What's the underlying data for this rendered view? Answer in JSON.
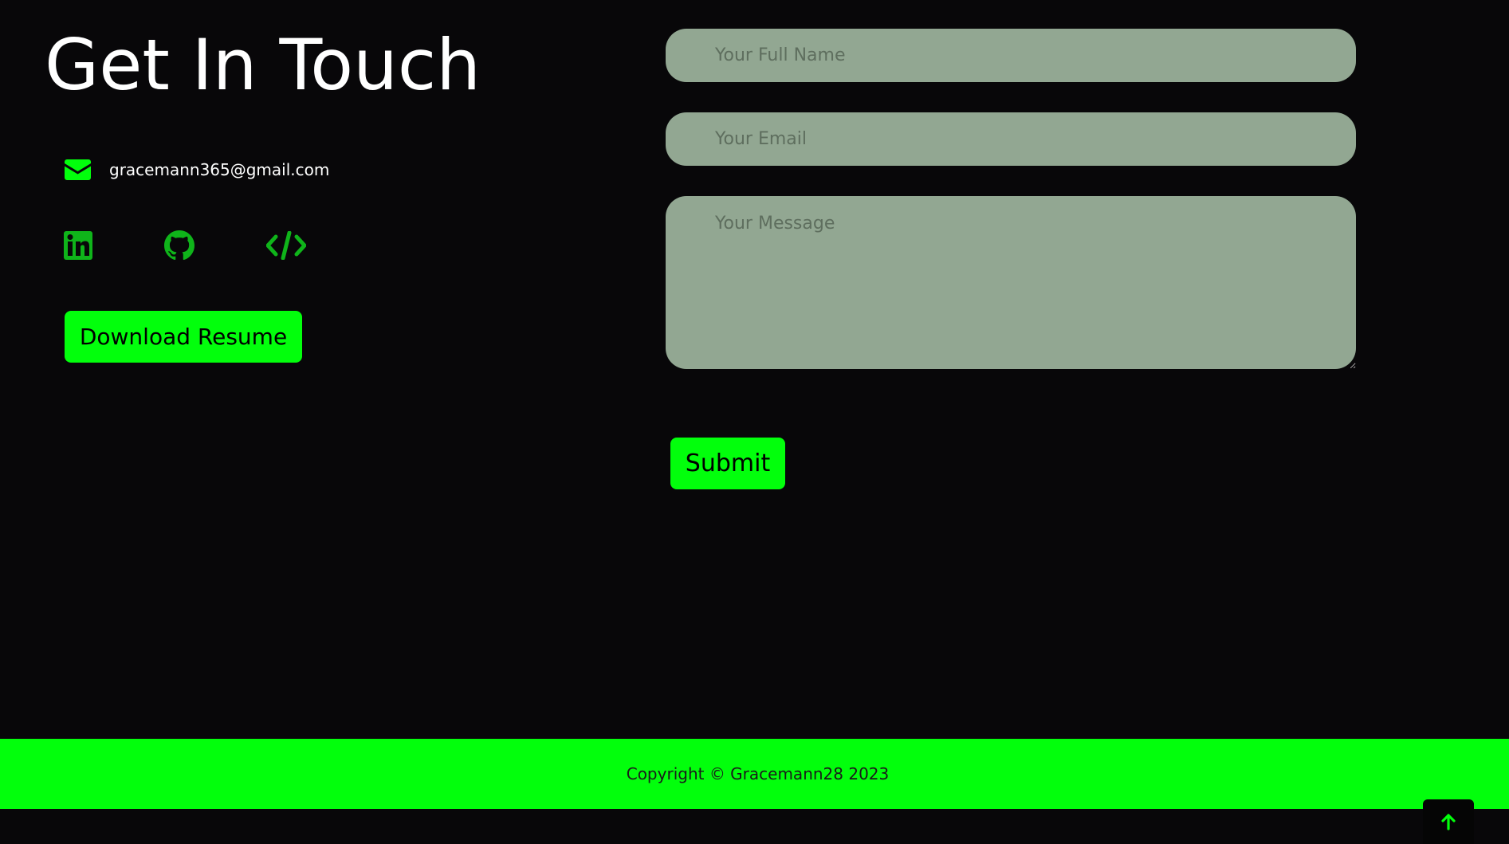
{
  "contact": {
    "title": "Get In Touch",
    "email": "gracemann365@gmail.com",
    "socials": [
      {
        "name": "linkedin-icon"
      },
      {
        "name": "github-icon"
      },
      {
        "name": "code-icon"
      }
    ],
    "resume_button_label": "Download Resume"
  },
  "form": {
    "name_placeholder": "Your Full Name",
    "name_value": "",
    "email_placeholder": "Your Email",
    "email_value": "",
    "message_placeholder": "Your Message",
    "message_value": "",
    "submit_label": "Submit"
  },
  "footer": {
    "copyright": "Copyright © Gracemann28 2023"
  },
  "scroll_top": {
    "icon": "arrow-up-icon"
  },
  "colors": {
    "background": "#080709",
    "accent_green": "#02ff0c",
    "icon_green": "#0fb41a",
    "field_bg": "#92a792",
    "text_white": "#ffffff"
  }
}
